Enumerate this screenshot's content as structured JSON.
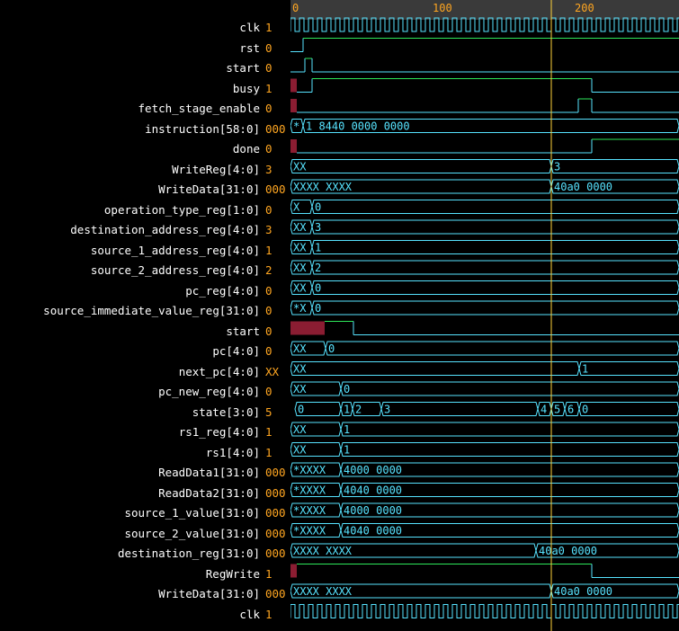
{
  "ruler": {
    "labels": [
      "0",
      "100",
      "200"
    ]
  },
  "signals": [
    {
      "name": "clk",
      "value": "1",
      "kind": "clock"
    },
    {
      "name": "rst",
      "value": "0",
      "kind": "bit"
    },
    {
      "name": "start",
      "value": "0",
      "kind": "bit"
    },
    {
      "name": "busy",
      "value": "1",
      "kind": "bit"
    },
    {
      "name": "fetch_stage_enable",
      "value": "0",
      "kind": "bit"
    },
    {
      "name": "instruction[58:0]",
      "value": "000",
      "kind": "bus",
      "labels": [
        "*",
        "1_8440_0000_0000"
      ]
    },
    {
      "name": "done",
      "value": "0",
      "kind": "bit"
    },
    {
      "name": "WriteReg[4:0]",
      "value": "3",
      "kind": "bus",
      "labels": [
        "XX",
        "3"
      ]
    },
    {
      "name": "WriteData[31:0]",
      "value": "000",
      "kind": "bus",
      "labels": [
        "XXXX_XXXX",
        "40a0_0000"
      ]
    },
    {
      "name": "operation_type_reg[1:0]",
      "value": "0",
      "kind": "bus",
      "labels": [
        "X",
        "0"
      ]
    },
    {
      "name": "destination_address_reg[4:0]",
      "value": "3",
      "kind": "bus",
      "labels": [
        "XX",
        "3"
      ]
    },
    {
      "name": "source_1_address_reg[4:0]",
      "value": "1",
      "kind": "bus",
      "labels": [
        "XX",
        "1"
      ]
    },
    {
      "name": "source_2_address_reg[4:0]",
      "value": "2",
      "kind": "bus",
      "labels": [
        "XX",
        "2"
      ]
    },
    {
      "name": "pc_reg[4:0]",
      "value": "0",
      "kind": "bus",
      "labels": [
        "XX",
        "0"
      ]
    },
    {
      "name": "source_immediate_value_reg[31:0]",
      "value": "0",
      "kind": "bus",
      "labels": [
        "*X",
        "0"
      ]
    },
    {
      "name": "start",
      "value": "0",
      "kind": "bit"
    },
    {
      "name": "pc[4:0]",
      "value": "0",
      "kind": "bus",
      "labels": [
        "XX",
        "0"
      ]
    },
    {
      "name": "next_pc[4:0]",
      "value": "XX",
      "kind": "bus",
      "labels": [
        "XX",
        "1"
      ]
    },
    {
      "name": "pc_new_reg[4:0]",
      "value": "0",
      "kind": "bus",
      "labels": [
        "XX",
        "0"
      ]
    },
    {
      "name": "state[3:0]",
      "value": "5",
      "kind": "bus",
      "labels": [
        "0",
        "1",
        "2",
        "3",
        "4",
        "5",
        "6",
        "0"
      ]
    },
    {
      "name": "rs1_reg[4:0]",
      "value": "1",
      "kind": "bus",
      "labels": [
        "XX",
        "1"
      ]
    },
    {
      "name": "rs1[4:0]",
      "value": "1",
      "kind": "bus",
      "labels": [
        "XX",
        "1"
      ]
    },
    {
      "name": "ReadData1[31:0]",
      "value": "000",
      "kind": "bus",
      "labels": [
        "*XXXX",
        "4000_0000"
      ]
    },
    {
      "name": "ReadData2[31:0]",
      "value": "000",
      "kind": "bus",
      "labels": [
        "*XXXX",
        "4040_0000"
      ]
    },
    {
      "name": "source_1_value[31:0]",
      "value": "000",
      "kind": "bus",
      "labels": [
        "*XXXX",
        "4000_0000"
      ]
    },
    {
      "name": "source_2_value[31:0]",
      "value": "000",
      "kind": "bus",
      "labels": [
        "*XXXX",
        "4040_0000"
      ]
    },
    {
      "name": "destination_reg[31:0]",
      "value": "000",
      "kind": "bus",
      "labels": [
        "XXXX_XXXX",
        "40a0_0000"
      ]
    },
    {
      "name": "RegWrite",
      "value": "1",
      "kind": "bit"
    },
    {
      "name": "WriteData[31:0]",
      "value": "000",
      "kind": "bus",
      "labels": [
        "XXXX_XXXX",
        "40a0_0000"
      ]
    },
    {
      "name": "clk",
      "value": "1",
      "kind": "clock"
    }
  ],
  "colors": {
    "background": "#000000",
    "signal_name": "#ffffff",
    "signal_value": "#ffa621",
    "wave": "#57e3ff",
    "bit_high": "#2ee85a",
    "undefined_fill": "#8b1d32",
    "cursor": "#ffd23a",
    "ruler_bg": "#3a3a3a",
    "ruler_text": "#ffa621"
  }
}
